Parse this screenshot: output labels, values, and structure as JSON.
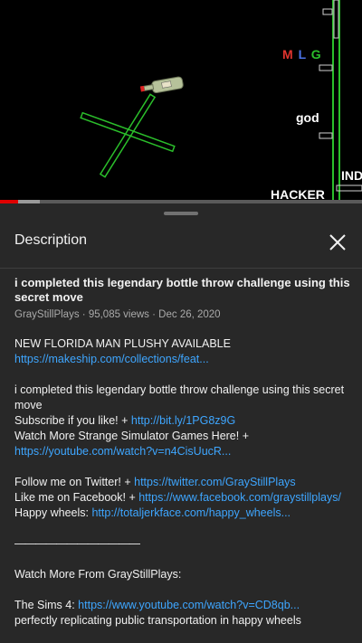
{
  "video": {
    "overlay_labels": {
      "mlg_m": "M",
      "mlg_l": "L",
      "mlg_g": "G",
      "god": "god",
      "ind": "IND",
      "hacker": "HACKER"
    },
    "progress_fraction": 0.05,
    "buffer_fraction": 0.11
  },
  "sheet": {
    "title": "Description",
    "close_icon": "close-icon"
  },
  "video_info": {
    "title": "i completed this legendary bottle throw challenge using this secret move",
    "channel": "GrayStillPlays",
    "views": "95,085 views",
    "date": "Dec 26, 2020"
  },
  "description": {
    "line1_text": "NEW FLORIDA MAN PLUSHY AVAILABLE ",
    "line1_link": "https://makeship.com/collections/feat...",
    "para2_line1": "i completed this legendary bottle throw challenge using this secret move",
    "subscribe_text": "Subscribe if you like!  + ",
    "subscribe_link": "http://bit.ly/1PG8z9G",
    "watch_more_text": "Watch More Strange Simulator Games Here! + ",
    "watch_more_link": "https://youtube.com/watch?v=n4CisUucR...",
    "twitter_text": "Follow me on Twitter! + ",
    "twitter_link": "https://twitter.com/GrayStillPlays",
    "facebook_text": "Like me on Facebook! + ",
    "facebook_link": "https://www.facebook.com/graystillplays/",
    "happy_text": "Happy wheels: ",
    "happy_link": "http://totaljerkface.com/happy_wheels...",
    "divider": "————————————",
    "watch_from": "Watch More From GrayStillPlays:",
    "sims_text": "The Sims 4: ",
    "sims_link": "https://www.youtube.com/watch?v=CD8qb...",
    "cutoff_line": "perfectly replicating public transportation in happy wheels"
  },
  "colors": {
    "accent_link": "#3ea6ff",
    "progress_red": "#e00000",
    "sheet_bg": "#282828"
  }
}
